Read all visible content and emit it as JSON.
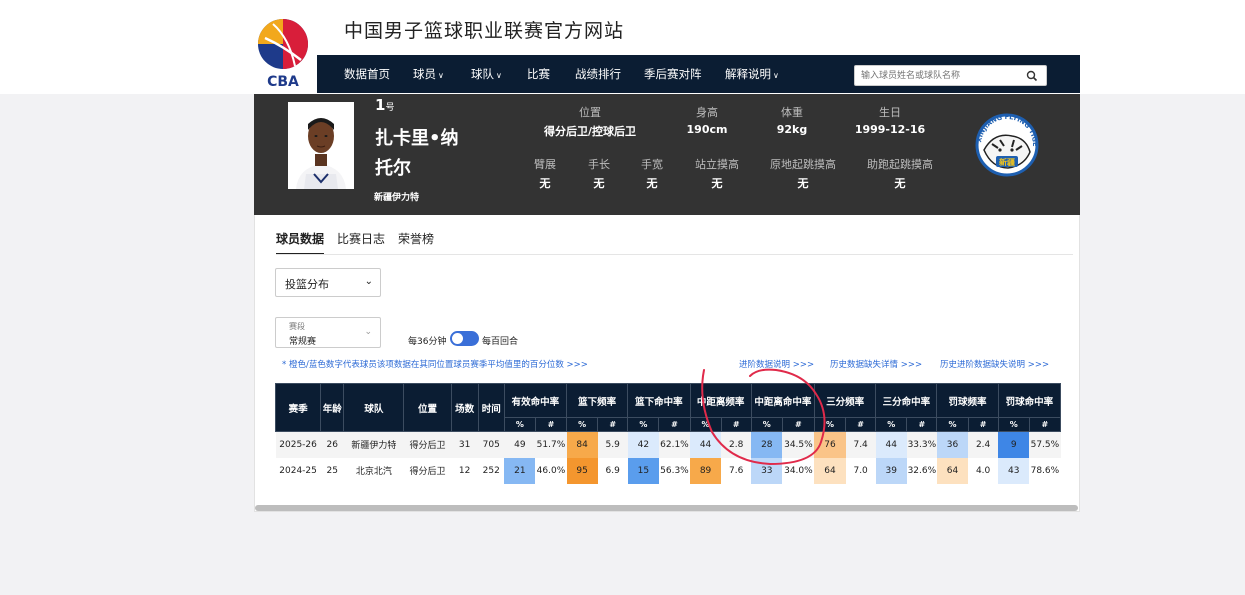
{
  "site": {
    "title": "中国男子篮球职业联赛官方网站",
    "logo_text": "CBA"
  },
  "nav": {
    "items": [
      {
        "label": "数据首页",
        "dropdown": false
      },
      {
        "label": "球员",
        "dropdown": true
      },
      {
        "label": "球队",
        "dropdown": true
      },
      {
        "label": "比赛",
        "dropdown": false
      },
      {
        "label": "战绩排行",
        "dropdown": false
      },
      {
        "label": "季后赛对阵",
        "dropdown": false
      },
      {
        "label": "解释说明",
        "dropdown": true
      }
    ],
    "search_placeholder": "输入球员姓名或球队名称"
  },
  "player": {
    "number": "1",
    "number_suffix": "号",
    "name": "扎卡里•纳托尔",
    "team": "新疆伊力特",
    "stats_row1": [
      {
        "label": "位置",
        "value": "得分后卫/控球后卫"
      },
      {
        "label": "身高",
        "value": "190cm"
      },
      {
        "label": "体重",
        "value": "92kg"
      },
      {
        "label": "生日",
        "value": "1999-12-16"
      }
    ],
    "stats_row2": [
      {
        "label": "臂展",
        "value": "无"
      },
      {
        "label": "手长",
        "value": "无"
      },
      {
        "label": "手宽",
        "value": "无"
      },
      {
        "label": "站立摸高",
        "value": "无"
      },
      {
        "label": "原地起跳摸高",
        "value": "无"
      },
      {
        "label": "助跑起跳摸高",
        "value": "无"
      }
    ],
    "team_logo_text": "新疆",
    "team_logo_ring": "XINJIANG FLYING TIGERS"
  },
  "tabs": [
    {
      "label": "球员数据",
      "active": true
    },
    {
      "label": "比赛日志",
      "active": false
    },
    {
      "label": "荣誉榜",
      "active": false
    }
  ],
  "filters": {
    "category": "投篮分布",
    "season_type_label": "赛段",
    "season_type": "常规赛",
    "toggle_left": "每36分钟",
    "toggle_right": "每百回合"
  },
  "note": "* 橙色/蓝色数字代表球员该项数据在其同位置球员赛季平均值里的百分位数 >>>",
  "links": [
    "进阶数据说明 >>>",
    "历史数据缺失详情 >>>",
    "历史进阶数据缺失说明 >>>"
  ],
  "table": {
    "base_headers": [
      "赛季",
      "年龄",
      "球队",
      "位置",
      "场数",
      "时间"
    ],
    "group_headers": [
      "有效命中率",
      "篮下频率",
      "篮下命中率",
      "中距离频率",
      "中距离命中率",
      "三分频率",
      "三分命中率",
      "罚球频率",
      "罚球命中率"
    ],
    "sub_headers": [
      "%",
      "#"
    ],
    "rows": [
      {
        "season": "2025-26",
        "age": "26",
        "team": "新疆伊力特",
        "pos": "得分后卫",
        "games": "31",
        "minutes": "705",
        "cells": [
          [
            "49",
            "51.7%"
          ],
          [
            "84",
            "5.9"
          ],
          [
            "42",
            "62.1%"
          ],
          [
            "44",
            "2.8"
          ],
          [
            "28",
            "34.5%"
          ],
          [
            "76",
            "7.4"
          ],
          [
            "44",
            "33.3%"
          ],
          [
            "36",
            "2.4"
          ],
          [
            "9",
            "57.5%"
          ]
        ]
      },
      {
        "season": "2024-25",
        "age": "25",
        "team": "北京北汽",
        "pos": "得分后卫",
        "games": "12",
        "minutes": "252",
        "cells": [
          [
            "21",
            "46.0%"
          ],
          [
            "95",
            "6.9"
          ],
          [
            "15",
            "56.3%"
          ],
          [
            "89",
            "7.6"
          ],
          [
            "33",
            "34.0%"
          ],
          [
            "64",
            "7.0"
          ],
          [
            "39",
            "32.6%"
          ],
          [
            "64",
            "4.0"
          ],
          [
            "43",
            "78.6%"
          ]
        ]
      }
    ]
  },
  "colors": {
    "nav_bg": "#0b1d33",
    "hero_bg": "#333333",
    "accent_blue": "#3a6fd8",
    "link_blue": "#2e6bd6",
    "annotation_red": "#e02a4a"
  }
}
